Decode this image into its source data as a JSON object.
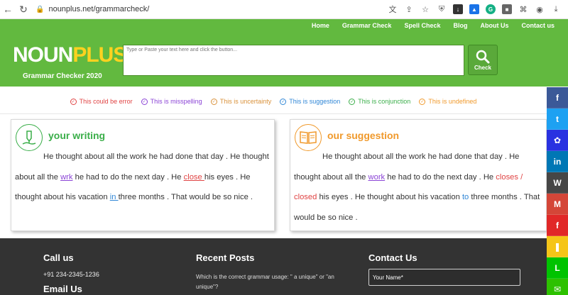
{
  "browser": {
    "url": "nounplus.net/grammarcheck/",
    "icons": [
      "back-arrow-icon",
      "reload-icon",
      "lock-icon",
      "translate-icon",
      "share-icon",
      "star-icon",
      "extension-icons",
      "download-icon"
    ]
  },
  "nav": {
    "items": [
      "Home",
      "Grammar Check",
      "Spell Check",
      "Blog",
      "About Us",
      "Contact us"
    ]
  },
  "logo": {
    "part1": "NOUN",
    "part2": "PLUS"
  },
  "tagline": "Grammar Checker 2020",
  "input": {
    "placeholder": "Type or Paste your text here and click the button...",
    "value": ""
  },
  "check_button": {
    "label": "Check"
  },
  "legend": [
    {
      "label": "This could be error",
      "color": "#e04444"
    },
    {
      "label": "This is misspelling",
      "color": "#8b44d6"
    },
    {
      "label": "This is uncertainty",
      "color": "#d9913a"
    },
    {
      "label": "This is suggestion",
      "color": "#2f86d6"
    },
    {
      "label": "This is conjunction",
      "color": "#3aae49"
    },
    {
      "label": "This is undefined",
      "color": "#f0992b"
    }
  ],
  "writing": {
    "title": "your writing",
    "title_color": "#3aae49",
    "p1": "He thought about all the work he had done that day . He thought about all the ",
    "w_mis": "wrk",
    "p2": " he had to do the next day . He ",
    "w_err": "close ",
    "p3": "his eyes . He thought about his vacation ",
    "w_sug": "in ",
    "p4": "three months . That would be so nice ."
  },
  "suggestion": {
    "title": "our suggestion",
    "title_color": "#f0992b",
    "p1": "He thought about all the work he had done that day . He thought about all the ",
    "s_mis": "work",
    "p2": " he had to do the next day . He ",
    "s_err": "closes / closed",
    "p3": " his eyes . He thought about his vacation ",
    "s_sug": "to",
    "p4": " three months . That would be so nice ."
  },
  "footer": {
    "call_title": "Call us",
    "phone": "+91 234-2345-1236",
    "email_title": "Email Us",
    "posts_title": "Recent Posts",
    "post1": "Which is the correct grammar usage: \" a unique\" or \"an unique\"?",
    "contact_title": "Contact Us",
    "name_placeholder": "Your Name*"
  },
  "social": [
    {
      "name": "facebook",
      "glyph": "f",
      "color": "#3b5998"
    },
    {
      "name": "twitter",
      "glyph": "t",
      "color": "#1da1f2"
    },
    {
      "name": "baidu",
      "glyph": "✿",
      "color": "#2932e1"
    },
    {
      "name": "linkedin",
      "glyph": "in",
      "color": "#0077b5"
    },
    {
      "name": "wordpress",
      "glyph": "W",
      "color": "#464646"
    },
    {
      "name": "gmail",
      "glyph": "M",
      "color": "#d44638"
    },
    {
      "name": "flipboard",
      "glyph": "f",
      "color": "#e12828"
    },
    {
      "name": "bookmark",
      "glyph": "❚",
      "color": "#f5c518"
    },
    {
      "name": "line",
      "glyph": "L",
      "color": "#00c300"
    },
    {
      "name": "wechat",
      "glyph": "✉",
      "color": "#2dc100"
    }
  ]
}
